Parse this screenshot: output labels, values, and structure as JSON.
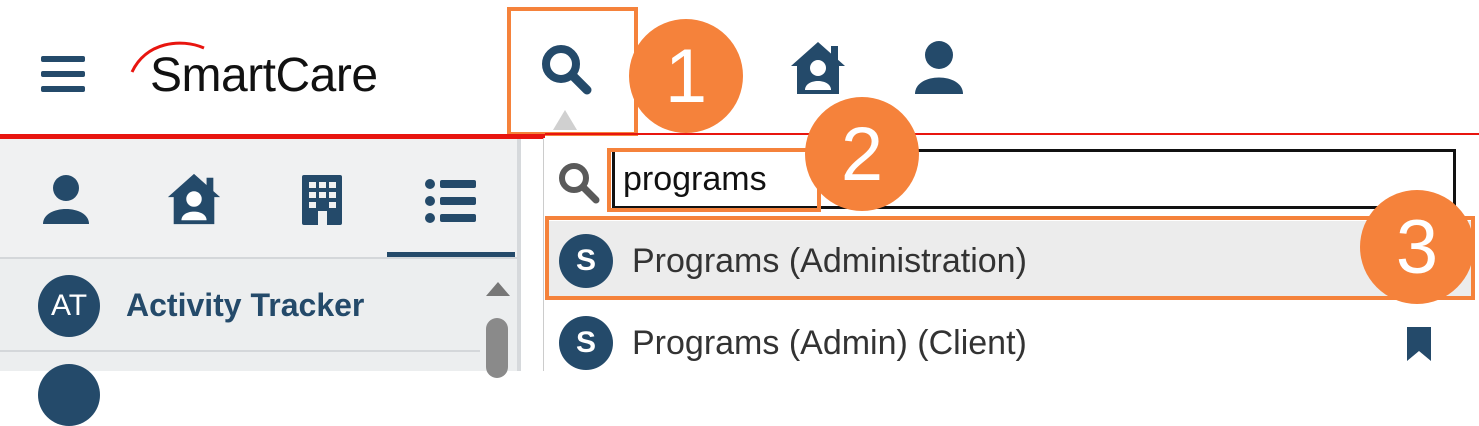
{
  "app": {
    "logo_text": "SmartCare"
  },
  "header": {
    "menu_icon": "hamburger-icon",
    "nav_icons": [
      "search-icon",
      "home-user-icon",
      "user-icon"
    ]
  },
  "callouts": {
    "one": "1",
    "two": "2",
    "three": "3"
  },
  "colors": {
    "accent_orange": "#f5823b",
    "brand_navy": "#244a6a",
    "brand_red": "#e8150f"
  },
  "left_panel": {
    "tabs": [
      {
        "icon": "user-icon"
      },
      {
        "icon": "home-user-icon"
      },
      {
        "icon": "building-icon"
      },
      {
        "icon": "list-icon",
        "selected": true
      }
    ],
    "items": [
      {
        "initials": "AT",
        "label": "Activity Tracker"
      }
    ]
  },
  "search": {
    "value": "programs",
    "results": [
      {
        "type_letter": "S",
        "label": "Programs (Administration)",
        "highlighted": true
      },
      {
        "type_letter": "S",
        "label": "Programs (Admin) (Client)",
        "bookmarked": true
      }
    ]
  }
}
